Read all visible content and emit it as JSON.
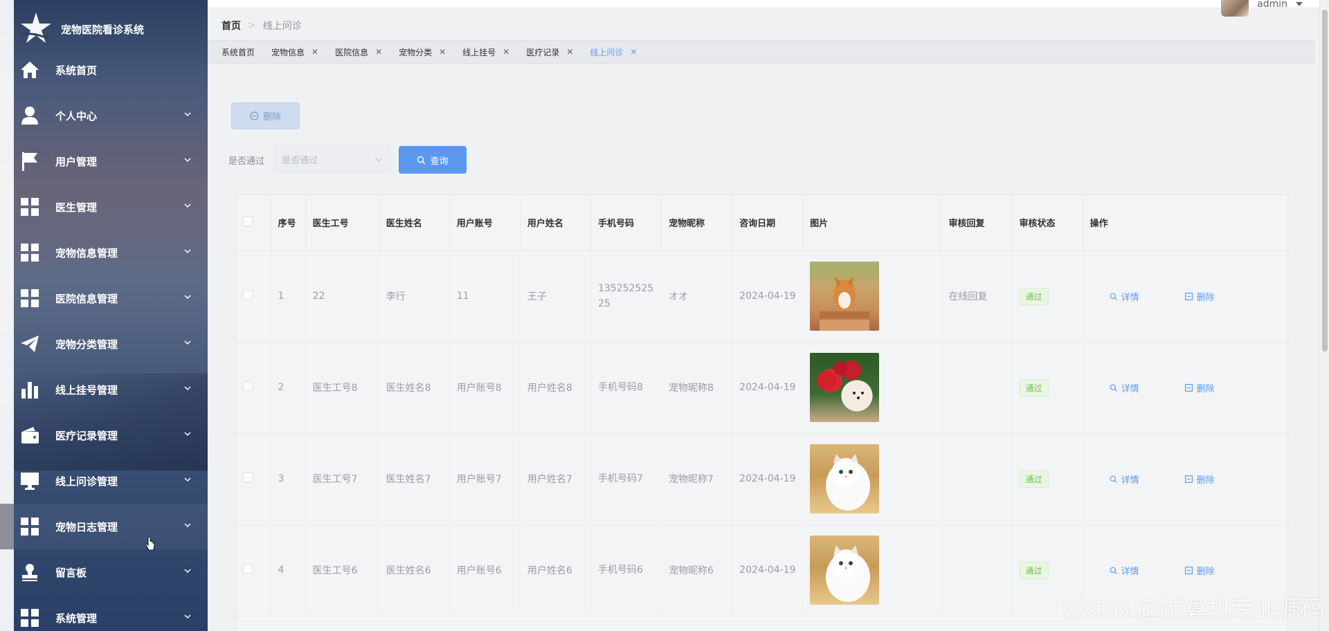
{
  "app": {
    "title": "宠物医院看诊系统"
  },
  "sidebar": {
    "items": [
      {
        "label": "系统首页",
        "icon": "home-icon",
        "expandable": false
      },
      {
        "label": "个人中心",
        "icon": "user-icon",
        "expandable": true
      },
      {
        "label": "用户管理",
        "icon": "flag-icon",
        "expandable": true
      },
      {
        "label": "医生管理",
        "icon": "grid-icon",
        "expandable": true
      },
      {
        "label": "宠物信息管理",
        "icon": "grid-icon",
        "expandable": true
      },
      {
        "label": "医院信息管理",
        "icon": "grid-icon",
        "expandable": true
      },
      {
        "label": "宠物分类管理",
        "icon": "paper-plane-icon",
        "expandable": true
      },
      {
        "label": "线上挂号管理",
        "icon": "bar-chart-icon",
        "expandable": true
      },
      {
        "label": "医疗记录管理",
        "icon": "wallet-icon",
        "expandable": true
      },
      {
        "label": "线上问诊管理",
        "icon": "monitor-icon",
        "expandable": true
      },
      {
        "label": "宠物日志管理",
        "icon": "grid-icon",
        "expandable": true
      },
      {
        "label": "留言板",
        "icon": "stamp-icon",
        "expandable": true
      },
      {
        "label": "系统管理",
        "icon": "grid-icon",
        "expandable": true
      }
    ]
  },
  "header": {
    "breadcrumb": {
      "home": "首页",
      "separator": ">",
      "current": "线上问诊"
    },
    "user": {
      "name": "admin"
    }
  },
  "tabs": [
    {
      "label": "系统首页",
      "closable": false,
      "active": false
    },
    {
      "label": "宠物信息",
      "closable": true,
      "active": false
    },
    {
      "label": "医院信息",
      "closable": true,
      "active": false
    },
    {
      "label": "宠物分类",
      "closable": true,
      "active": false
    },
    {
      "label": "线上挂号",
      "closable": true,
      "active": false
    },
    {
      "label": "医疗记录",
      "closable": true,
      "active": false
    },
    {
      "label": "线上问诊",
      "closable": true,
      "active": true
    }
  ],
  "toolbar": {
    "delete_label": "删除"
  },
  "filter": {
    "label": "是否通过",
    "placeholder": "是否通过",
    "query_label": "查询"
  },
  "table": {
    "columns": [
      "序号",
      "医生工号",
      "医生姓名",
      "用户账号",
      "用户姓名",
      "手机号码",
      "宠物昵称",
      "咨询日期",
      "图片",
      "审核回复",
      "审核状态",
      "操作"
    ],
    "rows": [
      {
        "index": "1",
        "doctor_id": "22",
        "doctor_name": "李行",
        "user_account": "11",
        "user_name": "王子",
        "phone": "13525252525",
        "pet_nickname": "オオ",
        "date": "2024-04-19",
        "image": "dog",
        "reply": "在线回复",
        "status": "通过"
      },
      {
        "index": "2",
        "doctor_id": "医生工号8",
        "doctor_name": "医生姓名8",
        "user_account": "用户账号8",
        "user_name": "用户姓名8",
        "phone": "手机号码8",
        "pet_nickname": "宠物昵称8",
        "date": "2024-04-19",
        "image": "flower",
        "reply": "",
        "status": "通过"
      },
      {
        "index": "3",
        "doctor_id": "医生工号7",
        "doctor_name": "医生姓名7",
        "user_account": "用户账号7",
        "user_name": "用户姓名7",
        "phone": "手机号码7",
        "pet_nickname": "宠物昵称7",
        "date": "2024-04-19",
        "image": "cat",
        "reply": "",
        "status": "通过"
      },
      {
        "index": "4",
        "doctor_id": "医生工号6",
        "doctor_name": "医生姓名6",
        "user_account": "用户账号6",
        "user_name": "用户姓名6",
        "phone": "手机号码6",
        "pet_nickname": "宠物昵称6",
        "date": "2024-04-19",
        "image": "cat",
        "reply": "",
        "status": "通过"
      }
    ],
    "actions": {
      "detail": "详情",
      "delete": "删除"
    }
  },
  "watermark": "CSDN @计算机专业源码",
  "colors": {
    "primary": "#5a98ee",
    "success": "#6cc04a",
    "active_tab": "#5a9cf8"
  }
}
